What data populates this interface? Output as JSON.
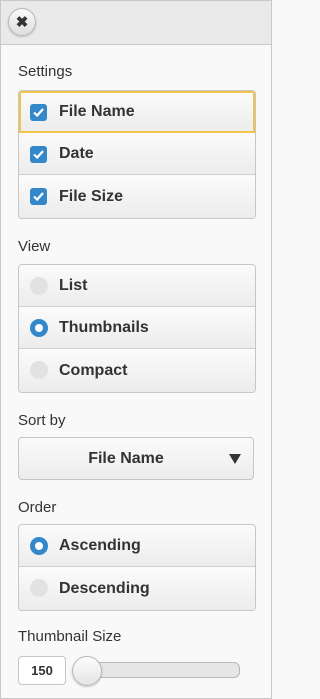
{
  "close_button": {
    "icon": "close-icon",
    "glyph": "✖"
  },
  "settings": {
    "label": "Settings",
    "items": [
      {
        "label": "File Name",
        "checked": true
      },
      {
        "label": "Date",
        "checked": true
      },
      {
        "label": "File Size",
        "checked": true
      }
    ]
  },
  "view": {
    "label": "View",
    "options": [
      {
        "label": "List",
        "selected": false
      },
      {
        "label": "Thumbnails",
        "selected": true
      },
      {
        "label": "Compact",
        "selected": false
      }
    ]
  },
  "sort_by": {
    "label": "Sort by",
    "value": "File Name"
  },
  "order": {
    "label": "Order",
    "options": [
      {
        "label": "Ascending",
        "selected": true
      },
      {
        "label": "Descending",
        "selected": false
      }
    ]
  },
  "thumbnail_size": {
    "label": "Thumbnail Size",
    "value": "150"
  },
  "colors": {
    "accent": "#3388cc",
    "focus": "#f1c44b"
  }
}
